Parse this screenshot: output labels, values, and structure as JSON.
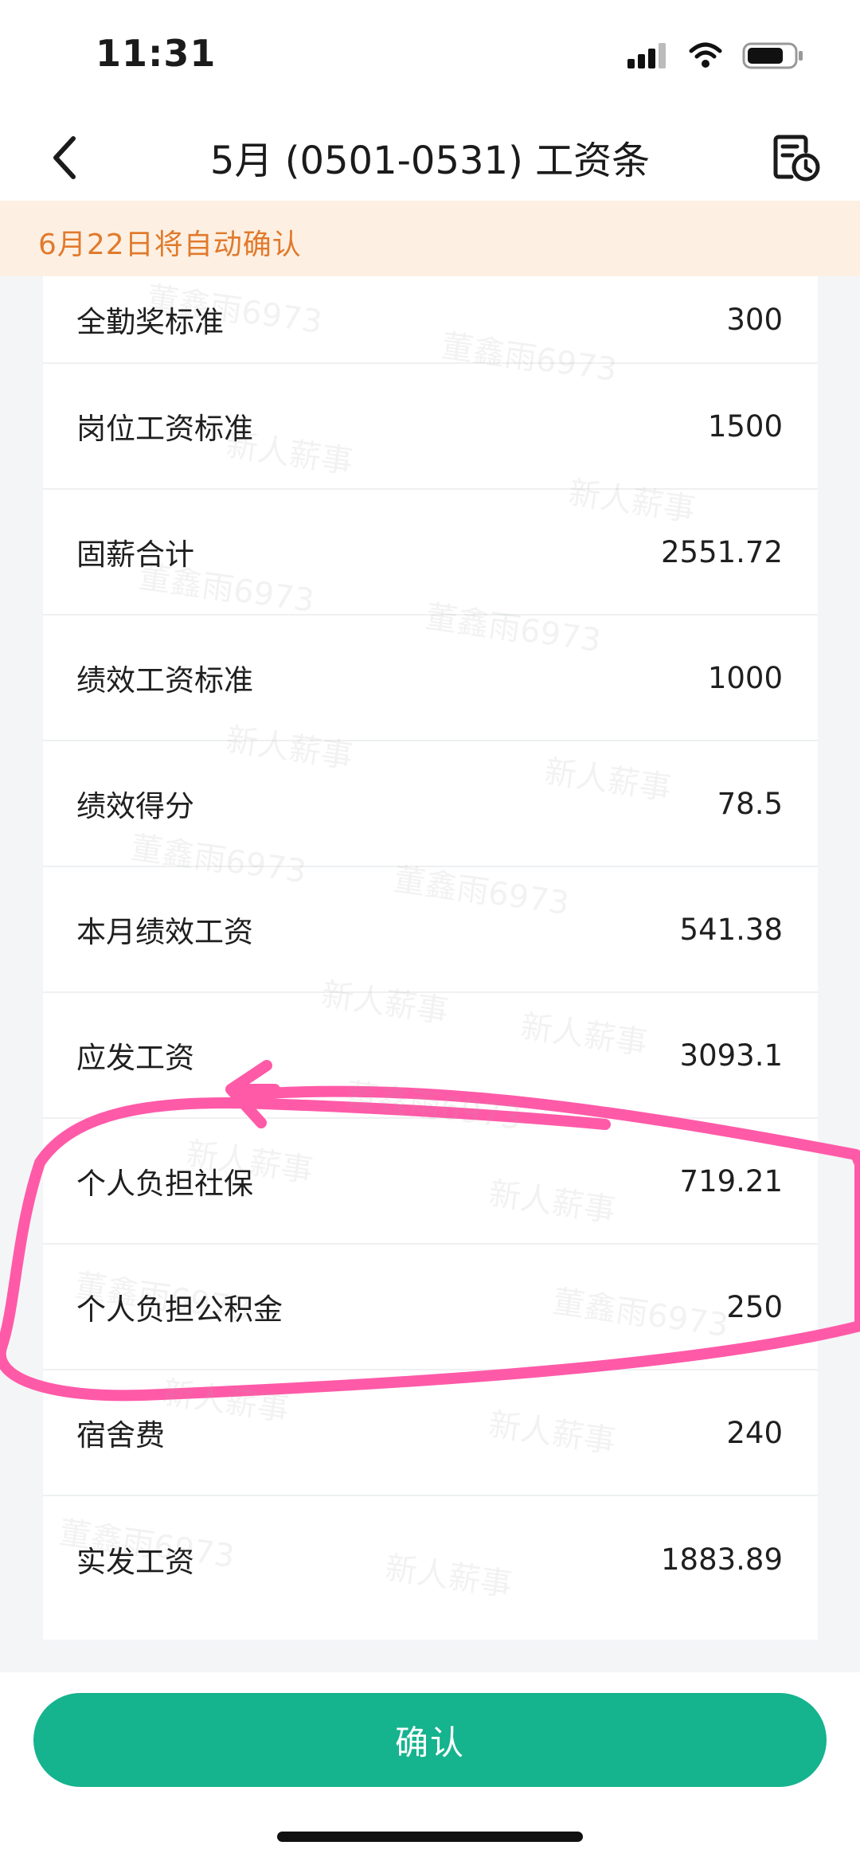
{
  "status_bar": {
    "time": "11:31"
  },
  "nav": {
    "title": "5月 (0501-0531) 工资条"
  },
  "notice": {
    "text": "6月22日将自动确认"
  },
  "rows": [
    {
      "label": "全勤奖标准",
      "value": "300"
    },
    {
      "label": "岗位工资标准",
      "value": "1500"
    },
    {
      "label": "固薪合计",
      "value": "2551.72"
    },
    {
      "label": "绩效工资标准",
      "value": "1000"
    },
    {
      "label": "绩效得分",
      "value": "78.5"
    },
    {
      "label": "本月绩效工资",
      "value": "541.38"
    },
    {
      "label": "应发工资",
      "value": "3093.1"
    },
    {
      "label": "个人负担社保",
      "value": "719.21"
    },
    {
      "label": "个人负担公积金",
      "value": "250"
    },
    {
      "label": "宿舍费",
      "value": "240"
    },
    {
      "label": "实发工资",
      "value": "1883.89"
    }
  ],
  "watermarks": [
    "董鑫雨6973",
    "新人薪事"
  ],
  "confirm": {
    "label": "确认"
  },
  "colors": {
    "accent": "#15b38e",
    "notice_text": "#e17a2c",
    "notice_bg": "#fdf0e3",
    "annotation": "#ff5aa8"
  }
}
